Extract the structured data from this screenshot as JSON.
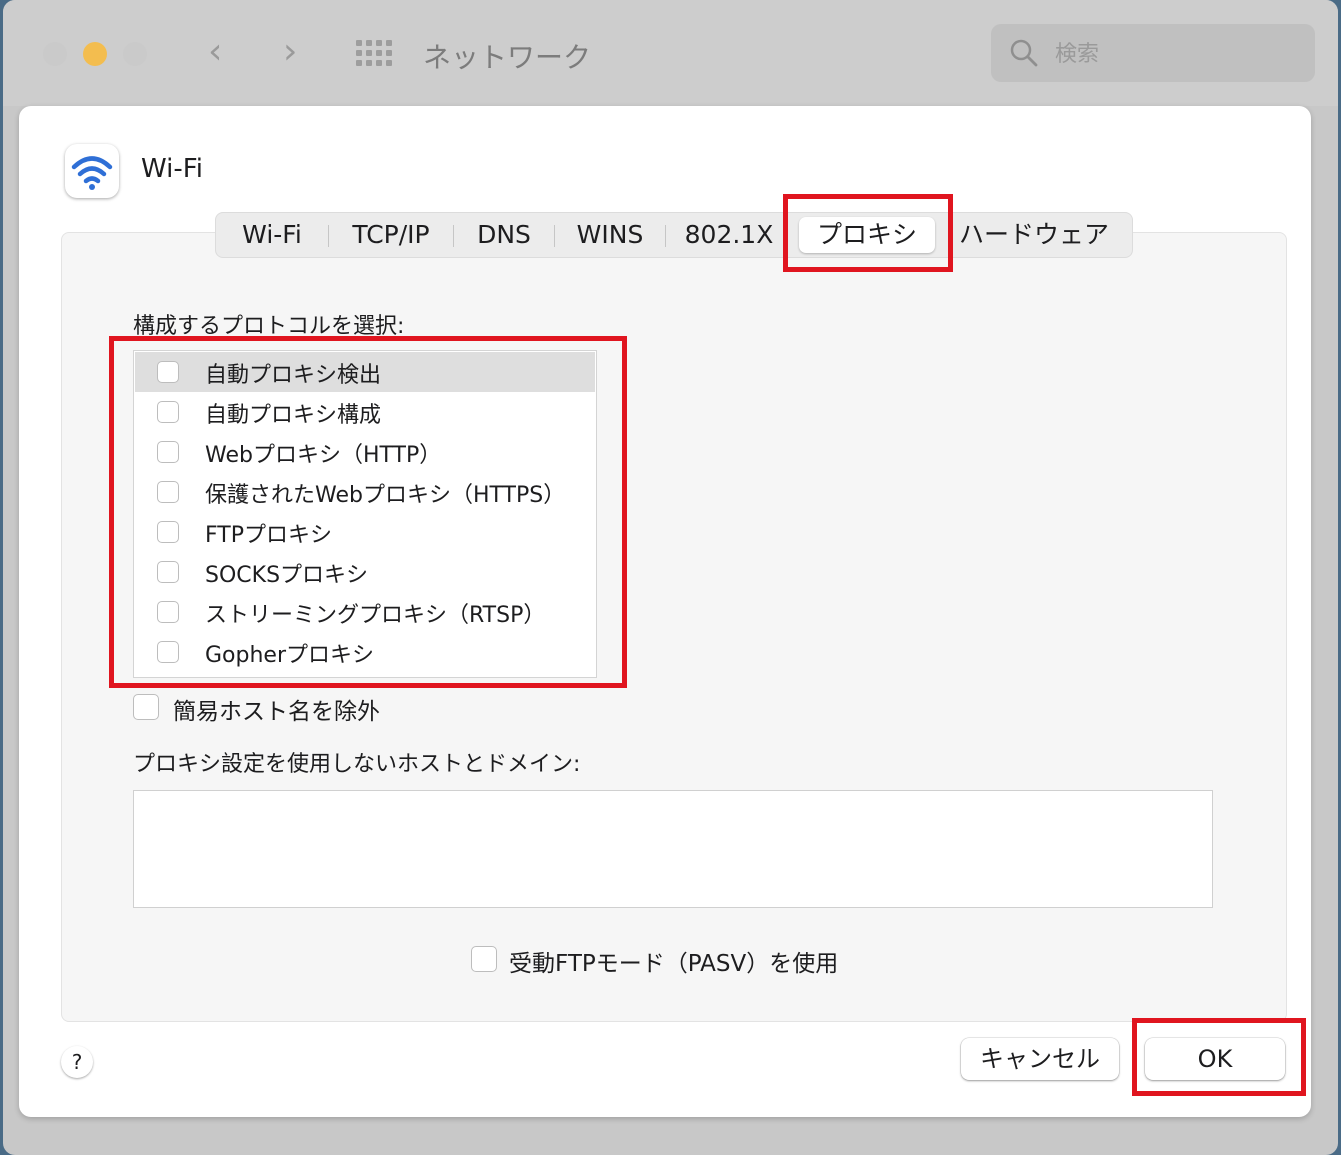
{
  "window": {
    "title": "ネットワーク"
  },
  "search": {
    "placeholder": "検索"
  },
  "service": {
    "name": "Wi-Fi"
  },
  "tabs": [
    {
      "label": "Wi-Fi"
    },
    {
      "label": "TCP/IP"
    },
    {
      "label": "DNS"
    },
    {
      "label": "WINS"
    },
    {
      "label": "802.1X"
    },
    {
      "label": "プロキシ",
      "selected": true
    },
    {
      "label": "ハードウェア"
    }
  ],
  "proxy": {
    "section_label": "構成するプロトコルを選択:",
    "protocols": [
      {
        "label": "自動プロキシ検出",
        "checked": false,
        "highlighted": true
      },
      {
        "label": "自動プロキシ構成",
        "checked": false
      },
      {
        "label": "Webプロキシ（HTTP）",
        "checked": false
      },
      {
        "label": "保護されたWebプロキシ（HTTPS）",
        "checked": false
      },
      {
        "label": "FTPプロキシ",
        "checked": false
      },
      {
        "label": "SOCKSプロキシ",
        "checked": false
      },
      {
        "label": "ストリーミングプロキシ（RTSP）",
        "checked": false
      },
      {
        "label": "Gopherプロキシ",
        "checked": false
      }
    ],
    "exclude_simple_hostnames": {
      "label": "簡易ホスト名を除外",
      "checked": false
    },
    "bypass_label": "プロキシ設定を使用しないホストとドメイン:",
    "bypass_value": "",
    "passive_ftp": {
      "label": "受動FTPモード（PASV）を使用",
      "checked": false
    }
  },
  "footer": {
    "help": "?",
    "cancel_label": "キャンセル",
    "ok_label": "OK"
  },
  "colors": {
    "highlight_box": "#e0151f",
    "wifi_blue": "#2f6fd6",
    "close": "#c9c9c9",
    "minimize": "#f3bd4f",
    "zoom": "#c9c9c9"
  }
}
